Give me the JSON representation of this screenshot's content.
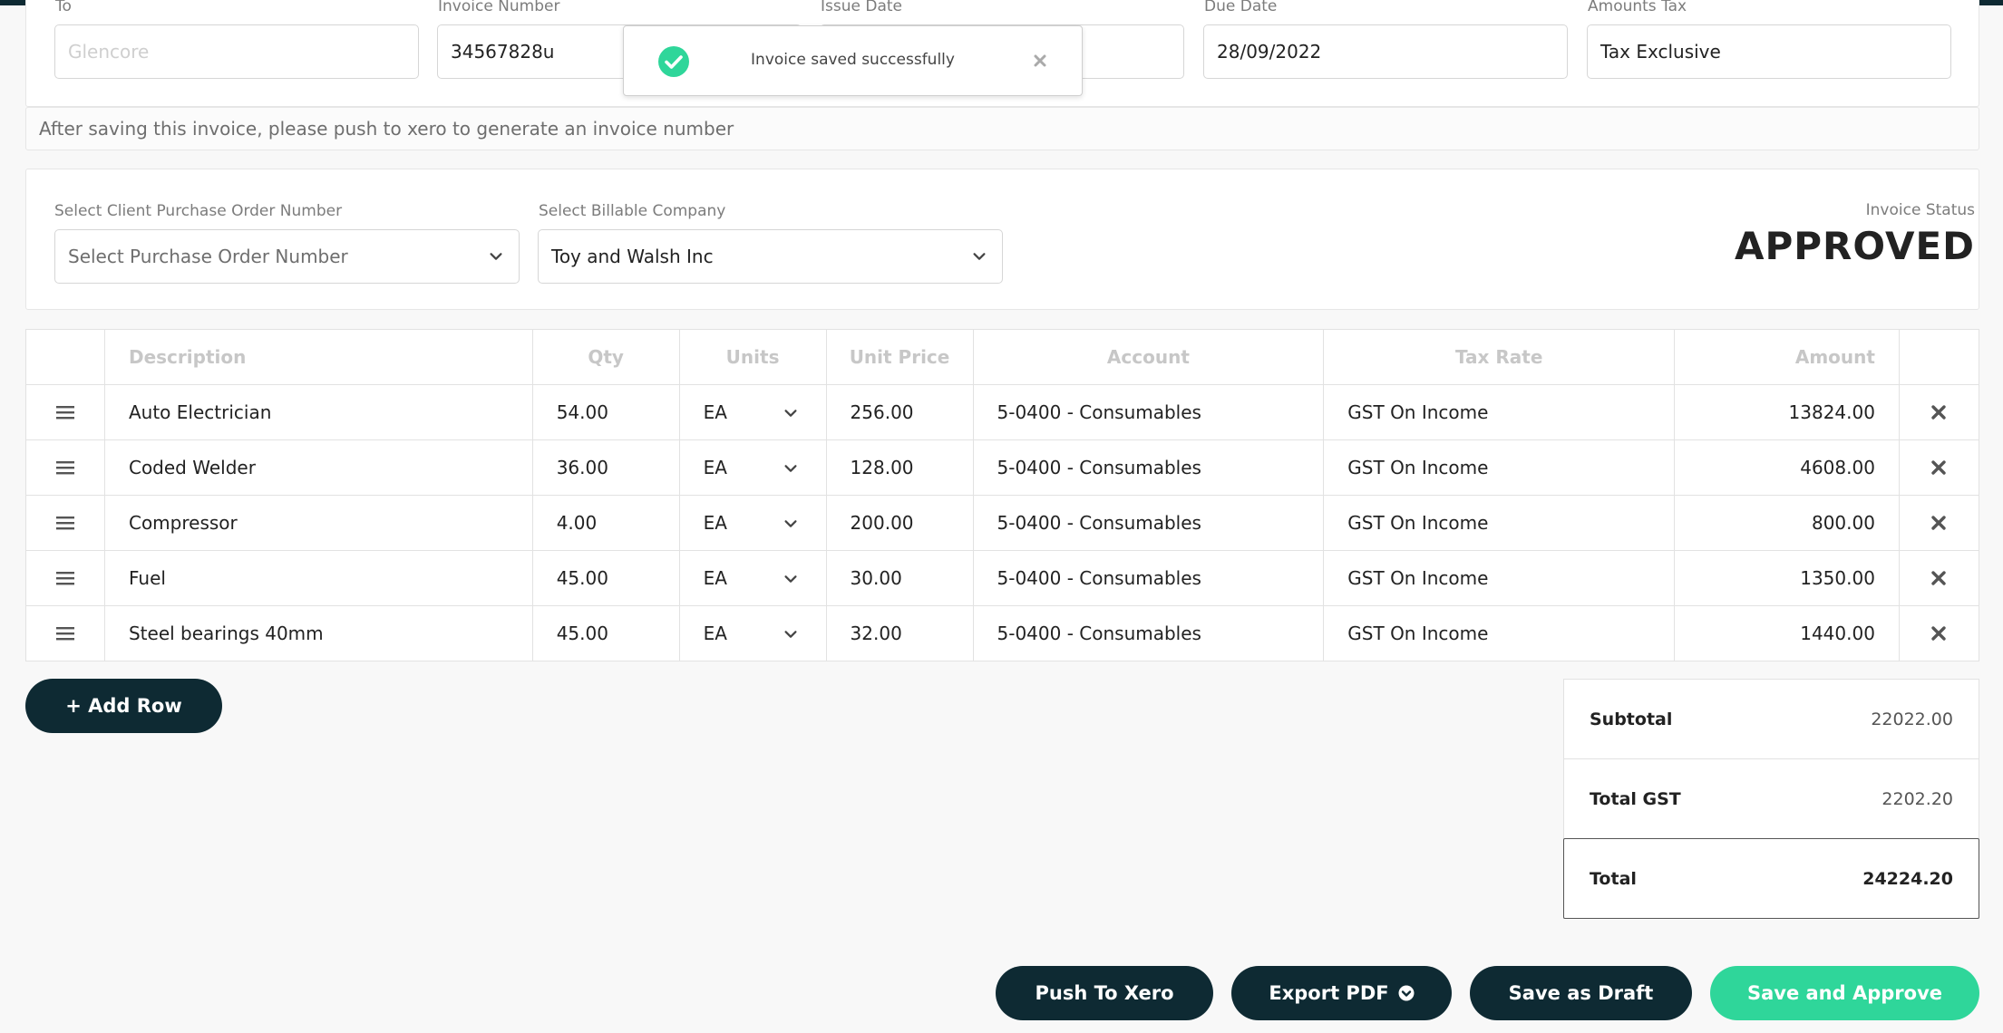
{
  "header": {
    "to": {
      "label": "To",
      "placeholder": "Glencore"
    },
    "invoice_number": {
      "label": "Invoice Number",
      "value": "34567828u"
    },
    "issue_date": {
      "label": "Issue Date",
      "value": ""
    },
    "due_date": {
      "label": "Due Date",
      "value": "28/09/2022"
    },
    "amounts_tax": {
      "label": "Amounts Tax",
      "value": "Tax Exclusive"
    }
  },
  "notice": "After saving this invoice, please push to xero to generate an invoice number",
  "selection": {
    "po_label": "Select Client Purchase Order Number",
    "po_placeholder": "Select Purchase Order Number",
    "company_label": "Select Billable Company",
    "company_value": "Toy and Walsh Inc",
    "status_label": "Invoice Status",
    "status_value": "APPROVED"
  },
  "table": {
    "columns": [
      "Description",
      "Qty",
      "Units",
      "Unit Price",
      "Account",
      "Tax Rate",
      "Amount"
    ],
    "rows": [
      {
        "description": "Auto Electrician",
        "qty": "54.00",
        "units": "EA",
        "unit_price": "256.00",
        "account": "5-0400 - Consumables",
        "tax_rate": "GST On Income",
        "amount": "13824.00"
      },
      {
        "description": "Coded Welder",
        "qty": "36.00",
        "units": "EA",
        "unit_price": "128.00",
        "account": "5-0400 - Consumables",
        "tax_rate": "GST On Income",
        "amount": "4608.00"
      },
      {
        "description": "Compressor",
        "qty": "4.00",
        "units": "EA",
        "unit_price": "200.00",
        "account": "5-0400 - Consumables",
        "tax_rate": "GST On Income",
        "amount": "800.00"
      },
      {
        "description": "Fuel",
        "qty": "45.00",
        "units": "EA",
        "unit_price": "30.00",
        "account": "5-0400 - Consumables",
        "tax_rate": "GST On Income",
        "amount": "1350.00"
      },
      {
        "description": "Steel bearings 40mm",
        "qty": "45.00",
        "units": "EA",
        "unit_price": "32.00",
        "account": "5-0400 - Consumables",
        "tax_rate": "GST On Income",
        "amount": "1440.00"
      }
    ]
  },
  "add_row_label": "+ Add Row",
  "totals": {
    "subtotal_label": "Subtotal",
    "subtotal": "22022.00",
    "gst_label": "Total GST",
    "gst": "2202.20",
    "total_label": "Total",
    "total": "24224.20"
  },
  "actions": {
    "push_xero": "Push To Xero",
    "export_pdf": "Export PDF",
    "save_draft": "Save as Draft",
    "save_approve": "Save and Approve"
  },
  "toast": {
    "message": "Invoice saved successfully"
  },
  "colors": {
    "dark": "#0e2a33",
    "accent": "#2fd69a"
  }
}
